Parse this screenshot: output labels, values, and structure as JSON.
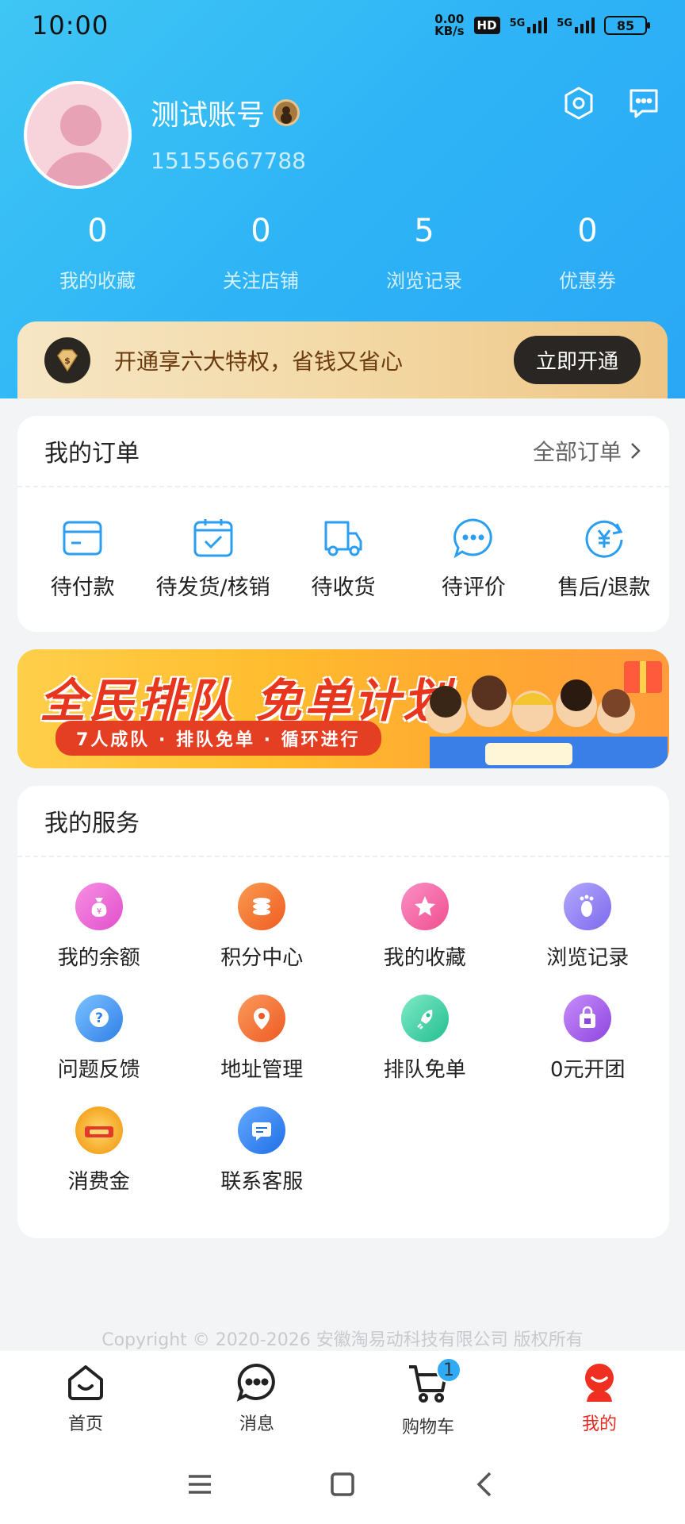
{
  "status_bar": {
    "time": "10:00",
    "speed_top": "0.00",
    "speed_bottom": "KB/s",
    "hd": "HD",
    "net1": "5G",
    "net2": "5G",
    "battery": "85"
  },
  "profile": {
    "name": "测试账号",
    "phone": "15155667788"
  },
  "stats": [
    {
      "value": "0",
      "label": "我的收藏"
    },
    {
      "value": "0",
      "label": "关注店铺"
    },
    {
      "value": "5",
      "label": "浏览记录"
    },
    {
      "value": "0",
      "label": "优惠券"
    }
  ],
  "vip": {
    "text": "开通享六大特权，省钱又省心",
    "button": "立即开通"
  },
  "orders": {
    "title": "我的订单",
    "more": "全部订单",
    "items": [
      {
        "label": "待付款",
        "icon": "wallet-icon"
      },
      {
        "label": "待发货/核销",
        "icon": "box-check-icon"
      },
      {
        "label": "待收货",
        "icon": "truck-icon"
      },
      {
        "label": "待评价",
        "icon": "comment-icon"
      },
      {
        "label": "售后/退款",
        "icon": "refund-icon"
      }
    ]
  },
  "banner": {
    "title": "全民排队 免单计划",
    "subtitle": "7人成队 · 排队免单 · 循环进行"
  },
  "services": {
    "title": "我的服务",
    "items": [
      {
        "label": "我的余额",
        "icon": "money-bag-icon",
        "color": "#e94fd0"
      },
      {
        "label": "积分中心",
        "icon": "coins-icon",
        "color": "#f2732b"
      },
      {
        "label": "我的收藏",
        "icon": "star-icon",
        "color": "#f25c9e"
      },
      {
        "label": "浏览记录",
        "icon": "footprint-icon",
        "color": "#8a7cf2"
      },
      {
        "label": "问题反馈",
        "icon": "question-icon",
        "color": "#3c8ff0"
      },
      {
        "label": "地址管理",
        "icon": "location-pin-icon",
        "color": "#f2692b"
      },
      {
        "label": "排队免单",
        "icon": "rocket-icon",
        "color": "#2fcfa0"
      },
      {
        "label": "0元开团",
        "icon": "shopping-bag-icon",
        "color": "#9b55e8"
      },
      {
        "label": "消费金",
        "icon": "coupon-coin-icon",
        "color": "#f6a821"
      },
      {
        "label": "联系客服",
        "icon": "chat-service-icon",
        "color": "#2d7ff0"
      }
    ]
  },
  "copyright": "Copyright © 2020-2026 安徽淘易动科技有限公司 版权所有",
  "tabbar": [
    {
      "label": "首页",
      "icon": "home-icon"
    },
    {
      "label": "消息",
      "icon": "message-icon"
    },
    {
      "label": "购物车",
      "icon": "cart-icon",
      "badge": "1"
    },
    {
      "label": "我的",
      "icon": "profile-icon",
      "active": true
    }
  ]
}
